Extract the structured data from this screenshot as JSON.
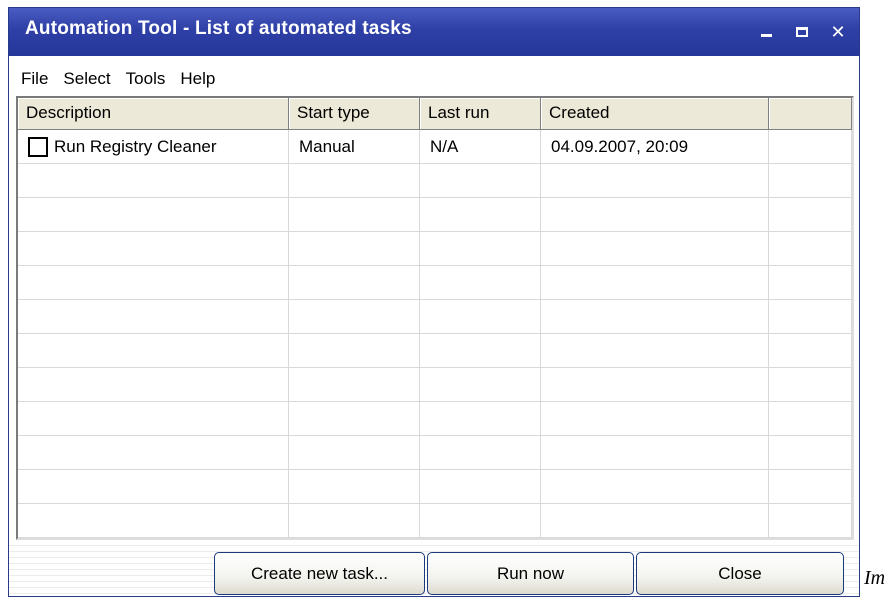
{
  "window": {
    "title": "Automation Tool - List of automated tasks",
    "title_bar_color": "#2e3fa6"
  },
  "menu": {
    "items": [
      {
        "label": "File"
      },
      {
        "label": "Select"
      },
      {
        "label": "Tools"
      },
      {
        "label": "Help"
      }
    ]
  },
  "table": {
    "columns": [
      "Description",
      "Start type",
      "Last run",
      "Created",
      ""
    ],
    "rows": [
      {
        "checked": false,
        "description": "Run Registry Cleaner",
        "start_type": "Manual",
        "last_run": "N/A",
        "created": "04.09.2007, 20:09"
      }
    ],
    "empty_row_count": 11
  },
  "buttons": {
    "create": "Create new task...",
    "run": "Run now",
    "close": "Close"
  },
  "icons": {
    "minimize": "minimize-icon",
    "maximize": "maximize-icon",
    "close": "close-icon",
    "checkbox": "checkbox-icon"
  },
  "stray_text": "Im"
}
